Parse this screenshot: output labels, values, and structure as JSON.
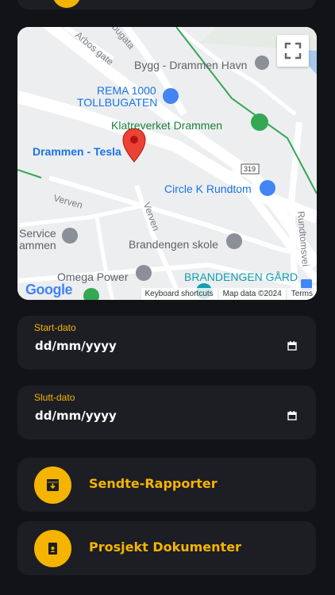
{
  "map": {
    "labels": {
      "bygg": "Bygg - Drammen Havn",
      "rema1": "REMA 1000",
      "rema2": "TOLLBUGATEN",
      "klatre": "Klatreverket Drammen",
      "pin": "Drammen - Tesla",
      "circlek": "Circle K Rundtom",
      "verven1": "Verven",
      "verven2": "Verven",
      "service1": "Service",
      "service2": "ammen",
      "brandengen_skole": "Brandengen skole",
      "omega": "Omega Power",
      "brandengen_gard": "BRANDENGEN GÅRD",
      "arbos": "Arbos gate",
      "bugata": "bugata",
      "rundtom": "Rundtomsvei",
      "road319": "319"
    },
    "google": "Google",
    "attribution": {
      "shortcuts": "Keyboard shortcuts",
      "data": "Map data ©2024",
      "terms": "Terms"
    },
    "icon": "fullscreen-icon"
  },
  "start": {
    "label": "Start-dato",
    "value": "dd/mm/yyyy"
  },
  "end": {
    "label": "Slutt-dato",
    "value": "dd/mm/yyyy"
  },
  "actions": {
    "sent": "Sendte-Rapporter",
    "docs": "Prosjekt Dokumenter"
  },
  "colors": {
    "accent": "#f5b400",
    "card": "#1d1e23",
    "background": "#121317"
  }
}
